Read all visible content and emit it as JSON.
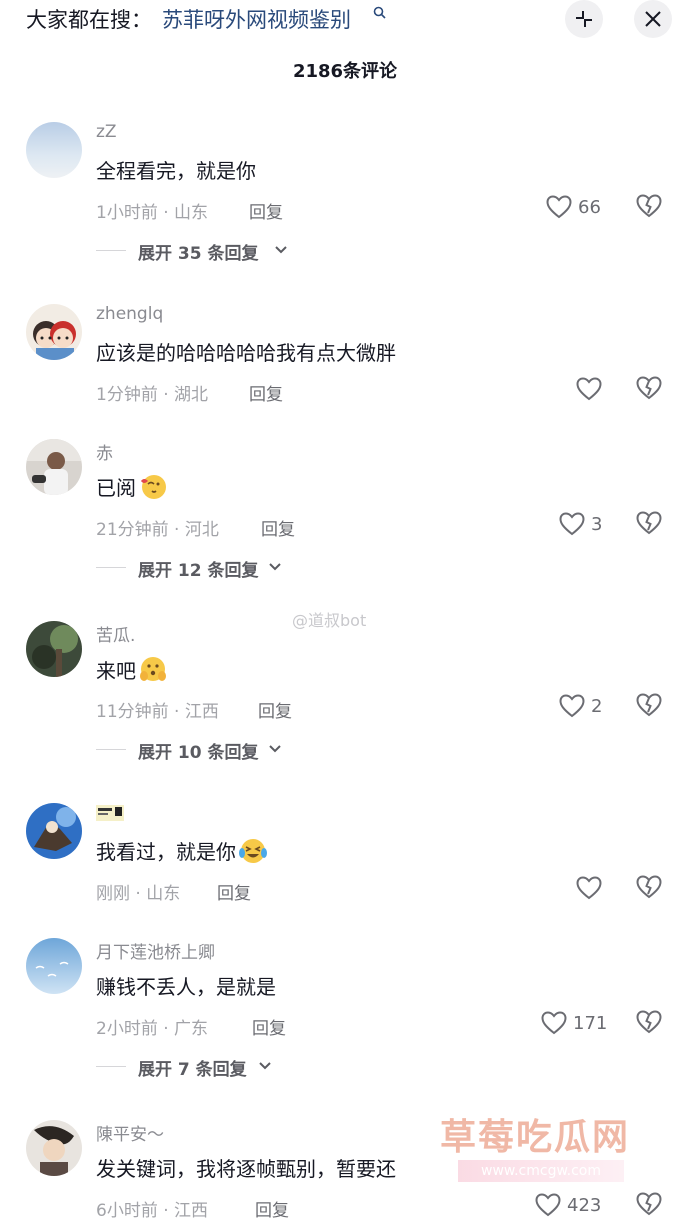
{
  "search": {
    "prefix": "大家都在搜：",
    "term": "苏菲呀外网视频鉴别",
    "icon": "search-icon"
  },
  "header": {
    "comment_count": "2186条评论",
    "collapse_icon": "collapse-icon",
    "close_icon": "close-icon"
  },
  "comments": [
    {
      "username": "zZ",
      "text": "全程看完，就是你",
      "meta": "1小时前 · 山东",
      "reply": "回复",
      "likes": "66",
      "expand": "展开 35 条回复"
    },
    {
      "username": "zhenglq",
      "text": "应该是的哈哈哈哈哈我有点大微胖",
      "meta": "1分钟前 · 湖北",
      "reply": "回复",
      "likes": ""
    },
    {
      "username": "赤",
      "text": "已阅",
      "emoji": "kiss-emoji",
      "meta": "21分钟前 · 河北",
      "reply": "回复",
      "likes": "3",
      "expand": "展开 12 条回复"
    },
    {
      "username": "苦瓜.",
      "text": "来吧",
      "emoji": "shy-emoji",
      "meta": "11分钟前 · 江西",
      "reply": "回复",
      "likes": "2",
      "expand": "展开 10 条回复"
    },
    {
      "username": "",
      "text": "我看过，就是你",
      "emoji": "laugh-cry-emoji",
      "meta": "刚刚 · 山东",
      "reply": "回复",
      "likes": ""
    },
    {
      "username": "月下莲池桥上卿",
      "text": "赚钱不丢人，是就是",
      "meta": "2小时前 · 广东",
      "reply": "回复",
      "likes": "171",
      "expand": "展开 7 条回复"
    },
    {
      "username": "陳平安～",
      "text": "发关键词，我将逐帧甄别，暂要还",
      "meta": "6小时前 · 江西",
      "reply": "回复",
      "likes": "423"
    }
  ],
  "watermarks": {
    "weibo": "@道叔bot",
    "site": "草莓吃瓜网",
    "url": "www.cmcgw.com"
  },
  "colors": {
    "accent_search": "#2a4a7b",
    "text_primary": "#161823",
    "text_secondary": "#a2a3a8"
  }
}
